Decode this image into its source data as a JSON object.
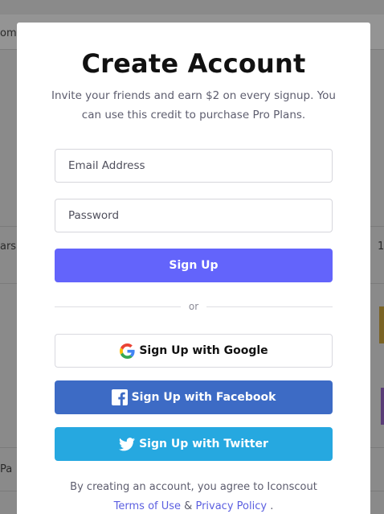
{
  "background": {
    "top_tab_fragment": "om",
    "row1_fragment": "ars l",
    "row1_right_fragment": "1",
    "row2_fragment": "Pa"
  },
  "modal": {
    "title": "Create Account",
    "subtitle": "Invite your friends and earn $2 on every signup. You can use this credit to purchase Pro Plans.",
    "email_placeholder": "Email Address",
    "password_placeholder": "Password",
    "signup_label": "Sign Up",
    "divider_text": "or",
    "google_label": "Sign Up with Google",
    "facebook_label": "Sign Up with Facebook",
    "twitter_label": "Sign Up with Twitter",
    "terms_text": "By creating an account, you agree to Iconscout",
    "terms_link": "Terms of Use",
    "terms_and": "&",
    "privacy_link": "Privacy Policy",
    "terms_end": "."
  },
  "colors": {
    "primary": "#6364fb",
    "facebook": "#3d6bc5",
    "twitter": "#26a8e0",
    "link": "#5b5fe0"
  },
  "icons": {
    "google": "google-icon",
    "facebook": "facebook-icon",
    "twitter": "twitter-icon"
  }
}
